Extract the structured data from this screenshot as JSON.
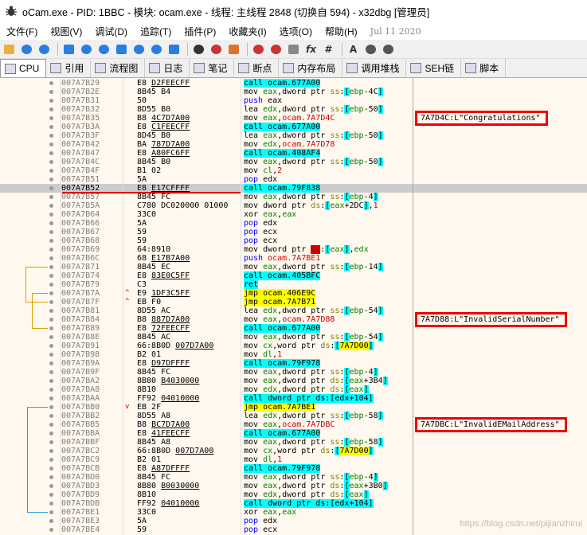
{
  "window": {
    "title": "oCam.exe - PID: 1BBC - 模块: ocam.exe - 线程: 主线程 2848 (切换自 594) - x32dbg [管理员]"
  },
  "menu": [
    "文件(F)",
    "视图(V)",
    "调试(D)",
    "追踪(T)",
    "插件(P)",
    "收藏夹(I)",
    "选项(O)",
    "帮助(H)"
  ],
  "menu_date": "Jul 11 2020",
  "toolbar_icons": [
    "open-icon",
    "restart-icon",
    "close-icon",
    "run-icon",
    "pause-icon",
    "step-into-icon",
    "step-over-icon",
    "animate-into-icon",
    "animate-over-icon",
    "execute-till-return-icon",
    "run-to-user-code-icon",
    "scylla-icon",
    "patch-icon",
    "bookmark-icon",
    "comment-icon",
    "label-icon",
    "function-icon",
    "hash-icon",
    "font-icon",
    "calculator-icon",
    "settings-icon"
  ],
  "toolbar_glyphs": {
    "font": "A",
    "function": "fx",
    "hash": "#"
  },
  "tabs": [
    {
      "label": "CPU",
      "icon": "cpu-icon",
      "active": true
    },
    {
      "label": "引用",
      "icon": "search-icon"
    },
    {
      "label": "流程图",
      "icon": "graph-icon"
    },
    {
      "label": "日志",
      "icon": "log-icon"
    },
    {
      "label": "笔记",
      "icon": "notes-icon"
    },
    {
      "label": "断点",
      "icon": "breakpoint-icon"
    },
    {
      "label": "内存布局",
      "icon": "memory-icon"
    },
    {
      "label": "调用堆栈",
      "icon": "callstack-icon"
    },
    {
      "label": "SEH链",
      "icon": "seh-icon"
    },
    {
      "label": "脚本",
      "icon": "script-icon"
    }
  ],
  "rows": [
    {
      "addr": "007A7B29",
      "bytes": "E8 D2FEECFF",
      "ins": "call ocam.677A00",
      "kind": "call"
    },
    {
      "addr": "007A7B2E",
      "bytes": "8B45 B4",
      "ins": "mov eax,dword ptr ss:[ebp-4C]"
    },
    {
      "addr": "007A7B31",
      "bytes": "50",
      "ins": "push eax",
      "kind": "push"
    },
    {
      "addr": "007A7B32",
      "bytes": "8D55 B0",
      "ins": "lea edx,dword ptr ss:[ebp-50]"
    },
    {
      "addr": "007A7B35",
      "bytes": "B8 4C7D7A00",
      "ins": "mov eax,ocam.7A7D4C"
    },
    {
      "addr": "007A7B3A",
      "bytes": "E8 C1FEECFF",
      "ins": "call ocam.677A00",
      "kind": "call"
    },
    {
      "addr": "007A7B3F",
      "bytes": "8D45 B0",
      "ins": "lea eax,dword ptr ss:[ebp-50]"
    },
    {
      "addr": "007A7B42",
      "bytes": "BA 787D7A00",
      "ins": "mov edx,ocam.7A7D78"
    },
    {
      "addr": "007A7B47",
      "bytes": "E8 A80FC6FF",
      "ins": "call ocam.408AF4",
      "kind": "call"
    },
    {
      "addr": "007A7B4C",
      "bytes": "8B45 B0",
      "ins": "mov eax,dword ptr ss:[ebp-50]"
    },
    {
      "addr": "007A7B4F",
      "bytes": "B1 02",
      "ins": "mov cl,2"
    },
    {
      "addr": "007A7B51",
      "bytes": "5A",
      "ins": "pop edx",
      "kind": "pop"
    },
    {
      "addr": "007A7B52",
      "bytes": "E8 E17CFFFF",
      "ins": "call ocam.79F838",
      "kind": "call",
      "cur": true
    },
    {
      "addr": "007A7B57",
      "bytes": "8B45 FC",
      "ins": "mov eax,dword ptr ss:[ebp-4]"
    },
    {
      "addr": "007A7B5A",
      "bytes": "C780 DC020000 01000",
      "ins": "mov dword ptr ds:[eax+2DC],1"
    },
    {
      "addr": "007A7B64",
      "bytes": "33C0",
      "ins": "xor eax,eax"
    },
    {
      "addr": "007A7B66",
      "bytes": "5A",
      "ins": "pop edx",
      "kind": "pop"
    },
    {
      "addr": "007A7B67",
      "bytes": "59",
      "ins": "pop ecx",
      "kind": "pop"
    },
    {
      "addr": "007A7B68",
      "bytes": "59",
      "ins": "pop ecx",
      "kind": "pop"
    },
    {
      "addr": "007A7B69",
      "bytes": "64:8910",
      "ins": "mov dword ptr fs:[eax],edx"
    },
    {
      "addr": "007A7B6C",
      "bytes": "68 E17B7A00",
      "ins": "push ocam.7A7BE1",
      "kind": "push"
    },
    {
      "addr": "007A7B71",
      "bytes": "8B45 EC",
      "ins": "mov eax,dword ptr ss:[ebp-14]"
    },
    {
      "addr": "007A7B74",
      "bytes": "E8 83E0C5FF",
      "ins": "call ocam.405BFC",
      "kind": "call"
    },
    {
      "addr": "007A7B79",
      "bytes": "C3",
      "ins": "ret",
      "kind": "ret"
    },
    {
      "addr": "007A7B7A",
      "bytes": "E9 1DF3C5FF",
      "ins": "jmp ocam.406E9C",
      "kind": "jmp",
      "arrow": "^"
    },
    {
      "addr": "007A7B7F",
      "bytes": "EB F0",
      "ins": "jmp ocam.7A7B71",
      "kind": "jmp",
      "arrow": "^"
    },
    {
      "addr": "007A7B81",
      "bytes": "8D55 AC",
      "ins": "lea edx,dword ptr ss:[ebp-54]"
    },
    {
      "addr": "007A7B84",
      "bytes": "B8 887D7A00",
      "ins": "mov eax,ocam.7A7D88"
    },
    {
      "addr": "007A7B89",
      "bytes": "E8 72FEECFF",
      "ins": "call ocam.677A00",
      "kind": "call"
    },
    {
      "addr": "007A7B8E",
      "bytes": "8B45 AC",
      "ins": "mov eax,dword ptr ss:[ebp-54]"
    },
    {
      "addr": "007A7B91",
      "bytes": "66:8B0D 007D7A00",
      "ins": "mov cx,word ptr ds:[7A7D00]"
    },
    {
      "addr": "007A7B98",
      "bytes": "B2 01",
      "ins": "mov dl,1"
    },
    {
      "addr": "007A7B9A",
      "bytes": "E8 D97DFFFF",
      "ins": "call ocam.79F978",
      "kind": "call"
    },
    {
      "addr": "007A7B9F",
      "bytes": "8B45 FC",
      "ins": "mov eax,dword ptr ss:[ebp-4]"
    },
    {
      "addr": "007A7BA2",
      "bytes": "8B80 B4030000",
      "ins": "mov eax,dword ptr ds:[eax+3B4]"
    },
    {
      "addr": "007A7BA8",
      "bytes": "8B10",
      "ins": "mov edx,dword ptr ds:[eax]"
    },
    {
      "addr": "007A7BAA",
      "bytes": "FF92 04010000",
      "ins": "call dword ptr ds:[edx+104]",
      "kind": "call"
    },
    {
      "addr": "007A7BB0",
      "bytes": "EB 2F",
      "ins": "jmp ocam.7A7BE1",
      "kind": "jmp",
      "arrow": "v"
    },
    {
      "addr": "007A7BB2",
      "bytes": "8D55 A8",
      "ins": "lea edx,dword ptr ss:[ebp-58]"
    },
    {
      "addr": "007A7BB5",
      "bytes": "B8 BC7D7A00",
      "ins": "mov eax,ocam.7A7DBC"
    },
    {
      "addr": "007A7BBA",
      "bytes": "E8 41FEECFF",
      "ins": "call ocam.677A00",
      "kind": "call"
    },
    {
      "addr": "007A7BBF",
      "bytes": "8B45 A8",
      "ins": "mov eax,dword ptr ss:[ebp-58]"
    },
    {
      "addr": "007A7BC2",
      "bytes": "66:8B0D 007D7A00",
      "ins": "mov cx,word ptr ds:[7A7D00]"
    },
    {
      "addr": "007A7BC9",
      "bytes": "B2 01",
      "ins": "mov dl,1"
    },
    {
      "addr": "007A7BCB",
      "bytes": "E8 A87DFFFF",
      "ins": "call ocam.79F978",
      "kind": "call"
    },
    {
      "addr": "007A7BD0",
      "bytes": "8B45 FC",
      "ins": "mov eax,dword ptr ss:[ebp-4]"
    },
    {
      "addr": "007A7BD3",
      "bytes": "8B80 B0030000",
      "ins": "mov eax,dword ptr ds:[eax+3B0]"
    },
    {
      "addr": "007A7BD9",
      "bytes": "8B10",
      "ins": "mov edx,dword ptr ds:[eax]"
    },
    {
      "addr": "007A7BDB",
      "bytes": "FF92 04010000",
      "ins": "call dword ptr ds:[edx+104]",
      "kind": "call"
    },
    {
      "addr": "007A7BE1",
      "bytes": "33C0",
      "ins": "xor eax,eax"
    },
    {
      "addr": "007A7BE3",
      "bytes": "5A",
      "ins": "pop edx",
      "kind": "pop"
    },
    {
      "addr": "007A7BE4",
      "bytes": "59",
      "ins": "pop ecx",
      "kind": "pop"
    }
  ],
  "comments": [
    {
      "row": 4,
      "text": "7A7D4C:L\"Congratulations\""
    },
    {
      "row": 27,
      "text": "7A7D88:L\"InvalidSerialNumber\""
    },
    {
      "row": 39,
      "text": "7A7DBC:L\"InvalidEMailAddress\""
    }
  ],
  "watermark": "https://blog.csdn.net/pijianzhirui"
}
